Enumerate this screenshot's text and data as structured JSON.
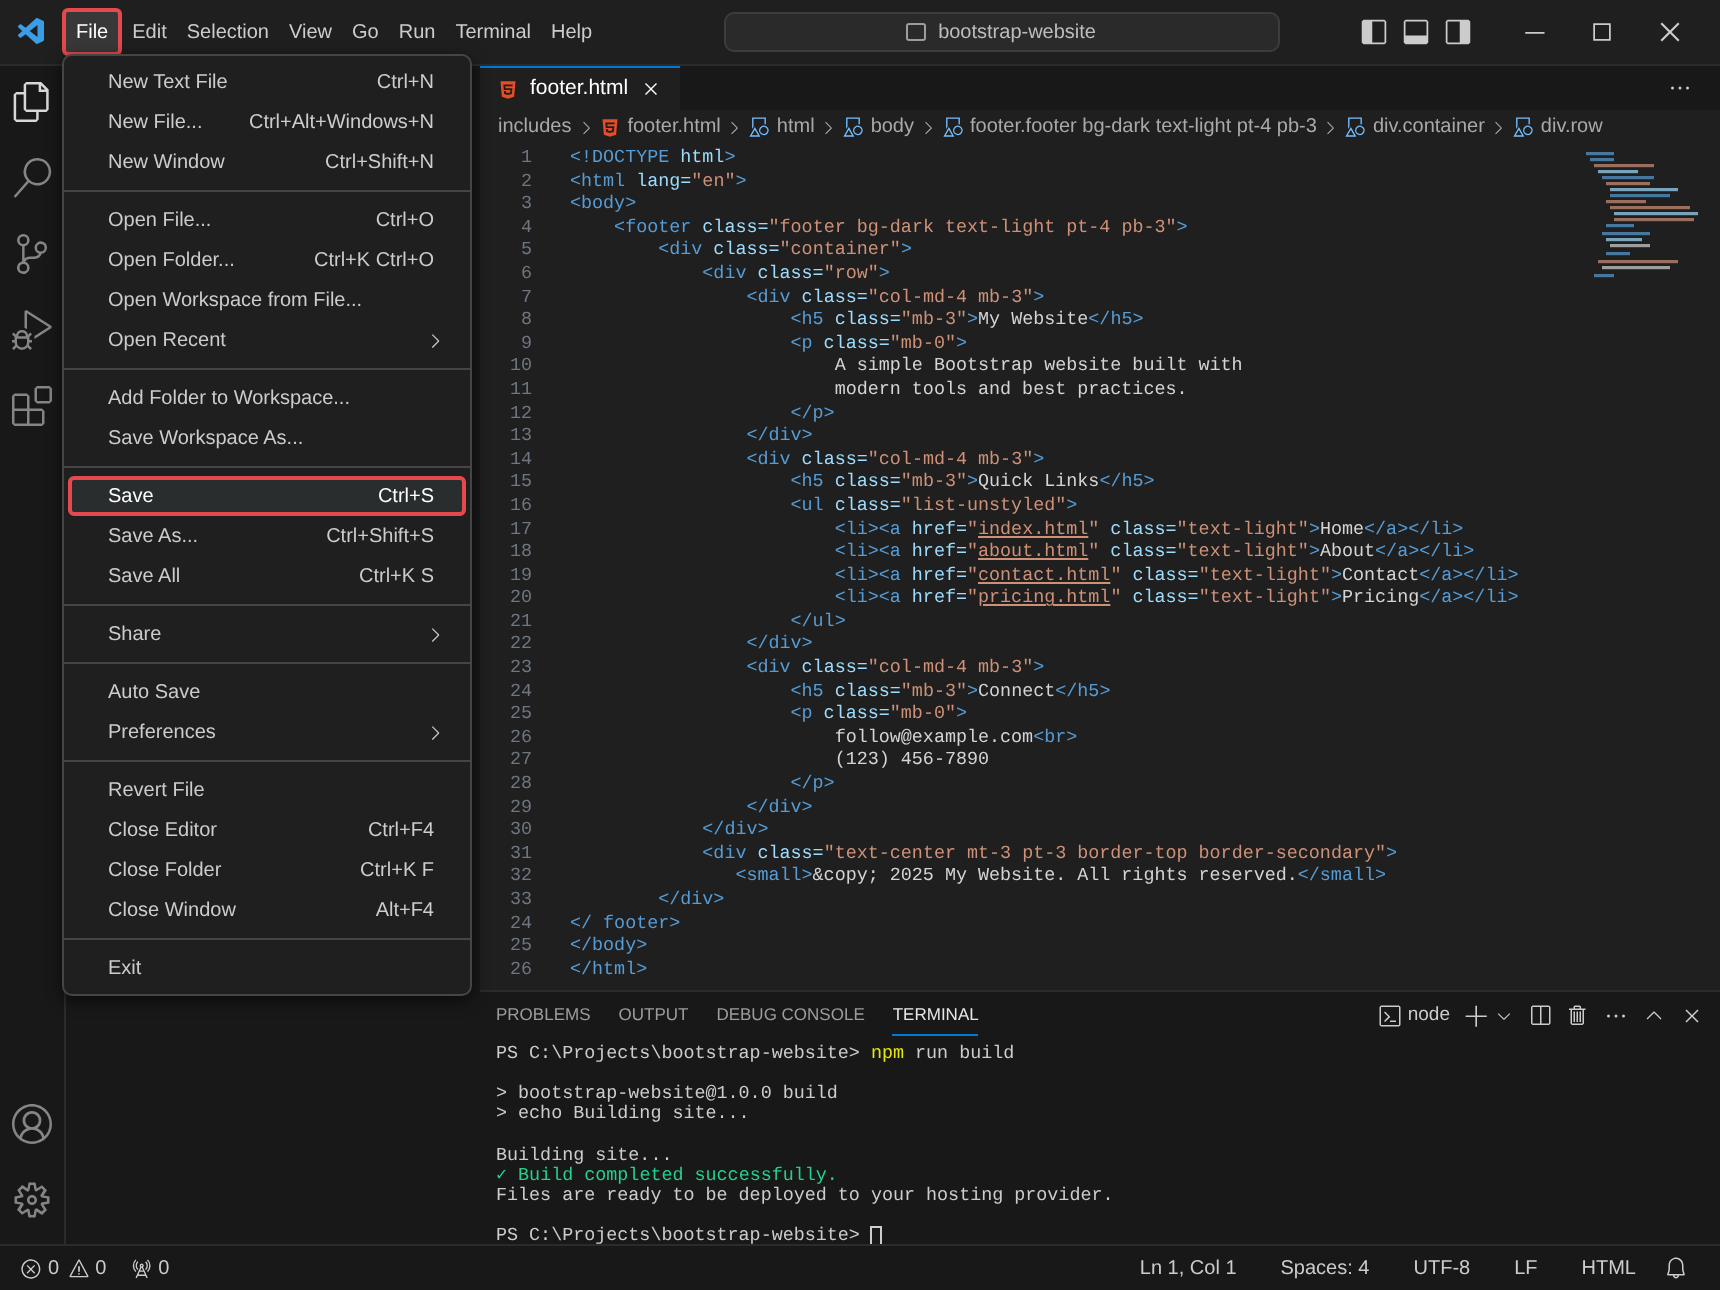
{
  "menubar": [
    {
      "label": "File",
      "selected": true
    },
    {
      "label": "Edit",
      "selected": false
    },
    {
      "label": "Selection",
      "selected": false
    },
    {
      "label": "View",
      "selected": false
    },
    {
      "label": "Go",
      "selected": false
    },
    {
      "label": "Run",
      "selected": false
    },
    {
      "label": "Terminal",
      "selected": false
    },
    {
      "label": "Help",
      "selected": false
    }
  ],
  "command_center": {
    "text": "bootstrap-website"
  },
  "file_menu": [
    [
      {
        "label": "New Text File",
        "shortcut": "Ctrl+N",
        "submenu": false,
        "highlighted": false
      },
      {
        "label": "New File...",
        "shortcut": "Ctrl+Alt+Windows+N",
        "submenu": false,
        "highlighted": false
      },
      {
        "label": "New Window",
        "shortcut": "Ctrl+Shift+N",
        "submenu": false,
        "highlighted": false
      }
    ],
    [
      {
        "label": "Open File...",
        "shortcut": "Ctrl+O",
        "submenu": false,
        "highlighted": false
      },
      {
        "label": "Open Folder...",
        "shortcut": "Ctrl+K Ctrl+O",
        "submenu": false,
        "highlighted": false
      },
      {
        "label": "Open Workspace from File...",
        "submenu": false,
        "highlighted": false
      },
      {
        "label": "Open Recent",
        "submenu": true,
        "highlighted": false
      }
    ],
    [
      {
        "label": "Add Folder to Workspace...",
        "submenu": false,
        "highlighted": false
      },
      {
        "label": "Save Workspace As...",
        "submenu": false,
        "highlighted": false
      }
    ],
    [
      {
        "label": "Save",
        "shortcut": "Ctrl+S",
        "submenu": false,
        "highlighted": true
      },
      {
        "label": "Save As...",
        "shortcut": "Ctrl+Shift+S",
        "submenu": false,
        "highlighted": false
      },
      {
        "label": "Save All",
        "shortcut": "Ctrl+K S",
        "submenu": false,
        "highlighted": false
      }
    ],
    [
      {
        "label": "Share",
        "submenu": true,
        "highlighted": false
      }
    ],
    [
      {
        "label": "Auto Save",
        "submenu": false,
        "highlighted": false
      },
      {
        "label": "Preferences",
        "submenu": true,
        "highlighted": false
      }
    ],
    [
      {
        "label": "Revert File",
        "submenu": false,
        "highlighted": false
      },
      {
        "label": "Close Editor",
        "shortcut": "Ctrl+F4",
        "submenu": false,
        "highlighted": false
      },
      {
        "label": "Close Folder",
        "shortcut": "Ctrl+K F",
        "submenu": false,
        "highlighted": false
      },
      {
        "label": "Close Window",
        "shortcut": "Alt+F4",
        "submenu": false,
        "highlighted": false
      }
    ],
    [
      {
        "label": "Exit",
        "submenu": false,
        "highlighted": false
      }
    ]
  ],
  "editor_tab": {
    "label": "footer.html",
    "selected": true
  },
  "breadcrumbs": [
    {
      "kind": "folder",
      "text": "includes"
    },
    {
      "kind": "file",
      "text": "footer.html"
    },
    {
      "kind": "element",
      "text": "html"
    },
    {
      "kind": "element",
      "text": "body"
    },
    {
      "kind": "element",
      "text": "footer.footer bg-dark text-light pt-4 pb-3"
    },
    {
      "kind": "element",
      "text": "div.container"
    },
    {
      "kind": "element",
      "text": "div.row"
    }
  ],
  "code_lines": [
    {
      "number": "1",
      "tokens": [
        {
          "kind": "tag",
          "text": "<!DOCTYPE"
        },
        {
          "kind": "attr",
          "text": " html"
        },
        {
          "kind": "tag",
          "text": ">"
        }
      ]
    },
    {
      "number": "2",
      "tokens": [
        {
          "kind": "tag",
          "text": "<html"
        },
        {
          "kind": "attr",
          "text": " lang="
        },
        {
          "kind": "string",
          "text": "\"en\""
        },
        {
          "kind": "tag",
          "text": ">"
        }
      ]
    },
    {
      "number": "3",
      "tokens": [
        {
          "kind": "tag",
          "text": "<body>"
        }
      ]
    },
    {
      "number": "4",
      "tokens": [
        {
          "kind": "tag",
          "text": "    <footer"
        },
        {
          "kind": "attr",
          "text": " class="
        },
        {
          "kind": "string",
          "text": "\"footer bg-dark text-light pt-4 pb-3\""
        },
        {
          "kind": "tag",
          "text": ">"
        }
      ]
    },
    {
      "number": "5",
      "tokens": [
        {
          "kind": "tag",
          "text": "        <div"
        },
        {
          "kind": "attr",
          "text": " class="
        },
        {
          "kind": "string",
          "text": "\"container\""
        },
        {
          "kind": "tag",
          "text": ">"
        }
      ]
    },
    {
      "number": "6",
      "tokens": [
        {
          "kind": "tag",
          "text": "            <div"
        },
        {
          "kind": "attr",
          "text": " class="
        },
        {
          "kind": "string",
          "text": "\"row\""
        },
        {
          "kind": "tag",
          "text": ">"
        }
      ]
    },
    {
      "number": "7",
      "tokens": [
        {
          "kind": "tag",
          "text": "                <div"
        },
        {
          "kind": "attr",
          "text": " class="
        },
        {
          "kind": "string",
          "text": "\"col-md-4 mb-3\""
        },
        {
          "kind": "tag",
          "text": ">"
        }
      ]
    },
    {
      "number": "8",
      "tokens": [
        {
          "kind": "tag",
          "text": "                    <h5"
        },
        {
          "kind": "attr",
          "text": " class="
        },
        {
          "kind": "string",
          "text": "\"mb-3\""
        },
        {
          "kind": "tag",
          "text": ">"
        },
        {
          "kind": "text",
          "text": "My Website"
        },
        {
          "kind": "tag",
          "text": "</h5>"
        }
      ]
    },
    {
      "number": "9",
      "tokens": [
        {
          "kind": "tag",
          "text": "                    <p"
        },
        {
          "kind": "attr",
          "text": " class="
        },
        {
          "kind": "string",
          "text": "\"mb-0\""
        },
        {
          "kind": "tag",
          "text": ">"
        }
      ]
    },
    {
      "number": "10",
      "tokens": [
        {
          "kind": "text",
          "text": "                        A simple Bootstrap website built with"
        }
      ]
    },
    {
      "number": "11",
      "tokens": [
        {
          "kind": "text",
          "text": "                        modern tools and best practices."
        }
      ]
    },
    {
      "number": "12",
      "tokens": [
        {
          "kind": "tag",
          "text": "                    </p>"
        }
      ]
    },
    {
      "number": "13",
      "tokens": [
        {
          "kind": "tag",
          "text": "                </div>"
        }
      ]
    },
    {
      "number": "14",
      "tokens": [
        {
          "kind": "tag",
          "text": "                <div"
        },
        {
          "kind": "attr",
          "text": " class="
        },
        {
          "kind": "string",
          "text": "\"col-md-4 mb-3\""
        },
        {
          "kind": "tag",
          "text": ">"
        }
      ]
    },
    {
      "number": "15",
      "tokens": [
        {
          "kind": "tag",
          "text": "                    <h5"
        },
        {
          "kind": "attr",
          "text": " class="
        },
        {
          "kind": "string",
          "text": "\"mb-3\""
        },
        {
          "kind": "tag",
          "text": ">"
        },
        {
          "kind": "text",
          "text": "Quick Links"
        },
        {
          "kind": "tag",
          "text": "</h5>"
        }
      ]
    },
    {
      "number": "16",
      "tokens": [
        {
          "kind": "tag",
          "text": "                    <ul"
        },
        {
          "kind": "attr",
          "text": " class="
        },
        {
          "kind": "string",
          "text": "\"list-unstyled\""
        },
        {
          "kind": "tag",
          "text": ">"
        }
      ]
    },
    {
      "number": "17",
      "tokens": [
        {
          "kind": "tag",
          "text": "                        <li><a"
        },
        {
          "kind": "attr",
          "text": " href="
        },
        {
          "kind": "string",
          "text": "\""
        },
        {
          "kind": "link",
          "text": "index.html"
        },
        {
          "kind": "string",
          "text": "\""
        },
        {
          "kind": "attr",
          "text": " class="
        },
        {
          "kind": "string",
          "text": "\"text-light\""
        },
        {
          "kind": "tag",
          "text": ">"
        },
        {
          "kind": "text",
          "text": "Home"
        },
        {
          "kind": "tag",
          "text": "</a></li>"
        }
      ]
    },
    {
      "number": "18",
      "tokens": [
        {
          "kind": "tag",
          "text": "                        <li><a"
        },
        {
          "kind": "attr",
          "text": " href="
        },
        {
          "kind": "string",
          "text": "\""
        },
        {
          "kind": "link",
          "text": "about.html"
        },
        {
          "kind": "string",
          "text": "\""
        },
        {
          "kind": "attr",
          "text": " class="
        },
        {
          "kind": "string",
          "text": "\"text-light\""
        },
        {
          "kind": "tag",
          "text": ">"
        },
        {
          "kind": "text",
          "text": "About"
        },
        {
          "kind": "tag",
          "text": "</a></li>"
        }
      ]
    },
    {
      "number": "19",
      "tokens": [
        {
          "kind": "tag",
          "text": "                        <li><a"
        },
        {
          "kind": "attr",
          "text": " href="
        },
        {
          "kind": "string",
          "text": "\""
        },
        {
          "kind": "link",
          "text": "contact.html"
        },
        {
          "kind": "string",
          "text": "\""
        },
        {
          "kind": "attr",
          "text": " class="
        },
        {
          "kind": "string",
          "text": "\"text-light\""
        },
        {
          "kind": "tag",
          "text": ">"
        },
        {
          "kind": "text",
          "text": "Contact"
        },
        {
          "kind": "tag",
          "text": "</a></li>"
        }
      ]
    },
    {
      "number": "20",
      "tokens": [
        {
          "kind": "tag",
          "text": "                        <li><a"
        },
        {
          "kind": "attr",
          "text": " href="
        },
        {
          "kind": "string",
          "text": "\""
        },
        {
          "kind": "link",
          "text": "pricing.html"
        },
        {
          "kind": "string",
          "text": "\""
        },
        {
          "kind": "attr",
          "text": " class="
        },
        {
          "kind": "string",
          "text": "\"text-light\""
        },
        {
          "kind": "tag",
          "text": ">"
        },
        {
          "kind": "text",
          "text": "Pricing"
        },
        {
          "kind": "tag",
          "text": "</a></li>"
        }
      ]
    },
    {
      "number": "21",
      "tokens": [
        {
          "kind": "tag",
          "text": "                    </ul>"
        }
      ]
    },
    {
      "number": "22",
      "tokens": [
        {
          "kind": "tag",
          "text": "                </div>"
        }
      ]
    },
    {
      "number": "23",
      "tokens": [
        {
          "kind": "tag",
          "text": "                <div"
        },
        {
          "kind": "attr",
          "text": " class="
        },
        {
          "kind": "string",
          "text": "\"col-md-4 mb-3\""
        },
        {
          "kind": "tag",
          "text": ">"
        }
      ]
    },
    {
      "number": "24",
      "tokens": [
        {
          "kind": "tag",
          "text": "                    <h5"
        },
        {
          "kind": "attr",
          "text": " class="
        },
        {
          "kind": "string",
          "text": "\"mb-3\""
        },
        {
          "kind": "tag",
          "text": ">"
        },
        {
          "kind": "text",
          "text": "Connect"
        },
        {
          "kind": "tag",
          "text": "</h5>"
        }
      ]
    },
    {
      "number": "25",
      "tokens": [
        {
          "kind": "tag",
          "text": "                    <p"
        },
        {
          "kind": "attr",
          "text": " class="
        },
        {
          "kind": "string",
          "text": "\"mb-0\""
        },
        {
          "kind": "tag",
          "text": ">"
        }
      ]
    },
    {
      "number": "26",
      "tokens": [
        {
          "kind": "text",
          "text": "                        follow@example.com"
        },
        {
          "kind": "tag",
          "text": "<br>"
        }
      ]
    },
    {
      "number": "27",
      "tokens": [
        {
          "kind": "text",
          "text": "                        (123) 456-7890"
        }
      ]
    },
    {
      "number": "28",
      "tokens": [
        {
          "kind": "tag",
          "text": "                    </p>"
        }
      ]
    },
    {
      "number": "29",
      "tokens": [
        {
          "kind": "tag",
          "text": "                </div>"
        }
      ]
    },
    {
      "number": "30",
      "tokens": [
        {
          "kind": "tag",
          "text": "            </div>"
        }
      ]
    },
    {
      "number": "31",
      "tokens": [
        {
          "kind": "tag",
          "text": "            <div"
        },
        {
          "kind": "attr",
          "text": " class="
        },
        {
          "kind": "string",
          "text": "\"text-center mt-3 pt-3 border-top border-secondary\""
        },
        {
          "kind": "tag",
          "text": ">"
        }
      ]
    },
    {
      "number": "32",
      "tokens": [
        {
          "kind": "tag",
          "text": "               <small>"
        },
        {
          "kind": "text",
          "text": "&copy; 2025 My Website. All rights reserved."
        },
        {
          "kind": "tag",
          "text": "</small>"
        }
      ]
    },
    {
      "number": "33",
      "tokens": [
        {
          "kind": "tag",
          "text": "        </div>"
        }
      ]
    },
    {
      "number": "24",
      "tokens": [
        {
          "kind": "tag",
          "text": "</ footer>"
        }
      ]
    },
    {
      "number": "25",
      "tokens": [
        {
          "kind": "tag",
          "text": "</body>"
        }
      ]
    },
    {
      "number": "26",
      "tokens": [
        {
          "kind": "tag",
          "text": "</html>"
        }
      ]
    }
  ],
  "panel_tabs": [
    {
      "label": "PROBLEMS",
      "selected": false
    },
    {
      "label": "OUTPUT",
      "selected": false
    },
    {
      "label": "DEBUG CONSOLE",
      "selected": false
    },
    {
      "label": "TERMINAL",
      "selected": true
    }
  ],
  "terminal_profile": "node",
  "terminal_blocks": [
    [
      [
        {
          "kind": "plain",
          "text": "PS C:\\Projects\\bootstrap-website> "
        },
        {
          "kind": "command",
          "text": "npm"
        },
        {
          "kind": "plain",
          "text": " run build"
        }
      ]
    ],
    [
      [
        {
          "kind": "plain",
          "text": "> bootstrap-website@1.0.0 build"
        }
      ],
      [
        {
          "kind": "plain",
          "text": "> echo Building site..."
        }
      ]
    ],
    [
      [
        {
          "kind": "plain",
          "text": "Building site..."
        }
      ],
      [
        {
          "kind": "success",
          "text": "✓ Build completed successfully."
        }
      ],
      [
        {
          "kind": "plain",
          "text": "Files are ready to be deployed to your hosting provider."
        }
      ]
    ],
    [
      [
        {
          "kind": "plain",
          "text": "PS C:\\Projects\\bootstrap-website> "
        }
      ]
    ]
  ],
  "terminal_cursor": true,
  "status_left": [
    {
      "kind": "errors",
      "text": "0"
    },
    {
      "kind": "warnings",
      "text": "0"
    },
    {
      "kind": "ports",
      "text": "0"
    }
  ],
  "status_right": [
    "Ln 1, Col 1",
    "Spaces: 4",
    "UTF-8",
    "LF",
    "HTML"
  ]
}
